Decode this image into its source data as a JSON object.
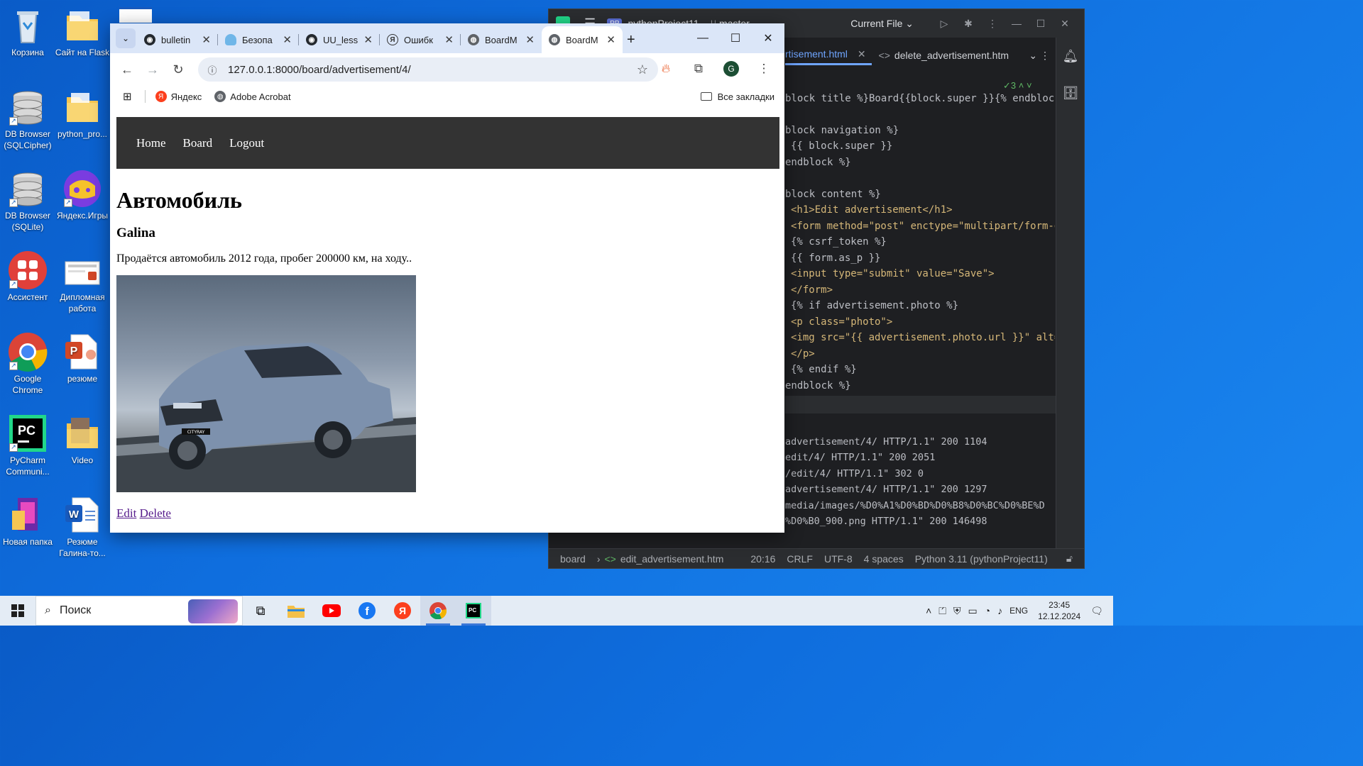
{
  "desktop": {
    "icons": [
      {
        "label": "Корзина"
      },
      {
        "label": "Сайт на Flask"
      },
      {
        "label": "DB Browser (SQLCipher)"
      },
      {
        "label": "python_pro..."
      },
      {
        "label": "DB Browser (SQLite)"
      },
      {
        "label": "Яндекс.Игры"
      },
      {
        "label": "Ассистент"
      },
      {
        "label": "Дипломная работа"
      },
      {
        "label": "Google Chrome"
      },
      {
        "label": "резюме"
      },
      {
        "label": "PyCharm Communi..."
      },
      {
        "label": "Video"
      },
      {
        "label": "Новая папка"
      },
      {
        "label": "Резюме Галина-то..."
      }
    ]
  },
  "ide": {
    "project": "pythonProject11",
    "project_badge": "PP",
    "branch": "master",
    "run_config": "Current File",
    "tabs": [
      "rtisement.html",
      "delete_advertisement.htm"
    ],
    "hint_count": "3",
    "code_lines": [
      "block title %}Board{{block.super }}{% endblock",
      "",
      "block navigation %}",
      "{{ block.super }}",
      "endblock %}",
      "",
      "block content %}",
      "<h1>Edit advertisement</h1>",
      "<form method=\"post\" enctype=\"multipart/form-da",
      "{% csrf_token %}",
      "{{ form.as_p }}",
      "<input type=\"submit\" value=\"Save\">",
      "</form>",
      "{% if advertisement.photo %}",
      "<p class=\"photo\">",
      "<img src=\"{{ advertisement.photo.url }}\" alt=",
      "</p>",
      "{% endif %}",
      "endblock %}"
    ],
    "log_lines": [
      "advertisement/4/ HTTP/1.1\" 200 1104",
      "edit/4/ HTTP/1.1\" 200 2051",
      "/edit/4/ HTTP/1.1\" 302 0",
      "advertisement/4/ HTTP/1.1\" 200 1297",
      "media/images/%D0%A1%D0%BD%D0%B8%D0%BC%D0%BE%D",
      "%D0%B0_900.png HTTP/1.1\" 200 146498"
    ],
    "status": {
      "breadcrumb_root": "board",
      "file": "edit_advertisement.htm",
      "position": "20:16",
      "line_sep": "CRLF",
      "encoding": "UTF-8",
      "indent": "4 spaces",
      "interpreter": "Python 3.11 (pythonProject11)"
    }
  },
  "browser": {
    "tabs": [
      {
        "title": "bulletin",
        "icon": "github-icon"
      },
      {
        "title": "Безопа",
        "icon": "cloud-icon"
      },
      {
        "title": "UU_less",
        "icon": "github-icon"
      },
      {
        "title": "Ошибк",
        "icon": "yandex-icon"
      },
      {
        "title": "BoardM",
        "icon": "globe-icon"
      },
      {
        "title": "BoardM",
        "icon": "globe-icon",
        "active": true
      }
    ],
    "url": "127.0.0.1:8000/board/advertisement/4/",
    "avatar_letter": "G",
    "bookmarks": [
      "Яндекс",
      "Adobe Acrobat"
    ],
    "all_bookmarks": "Все закладки"
  },
  "page": {
    "nav": [
      "Home",
      "Board",
      "Logout"
    ],
    "title": "Автомобиль",
    "author": "Galina",
    "description": "Продаётся автомобиль 2012 года, пробег 200000 км, на ходу..",
    "photo_badge": "CITYRAY",
    "actions": {
      "edit": "Edit",
      "delete": "Delete"
    }
  },
  "taskbar": {
    "search_placeholder": "Поиск",
    "language": "ENG",
    "time": "23:45",
    "date": "12.12.2024"
  }
}
